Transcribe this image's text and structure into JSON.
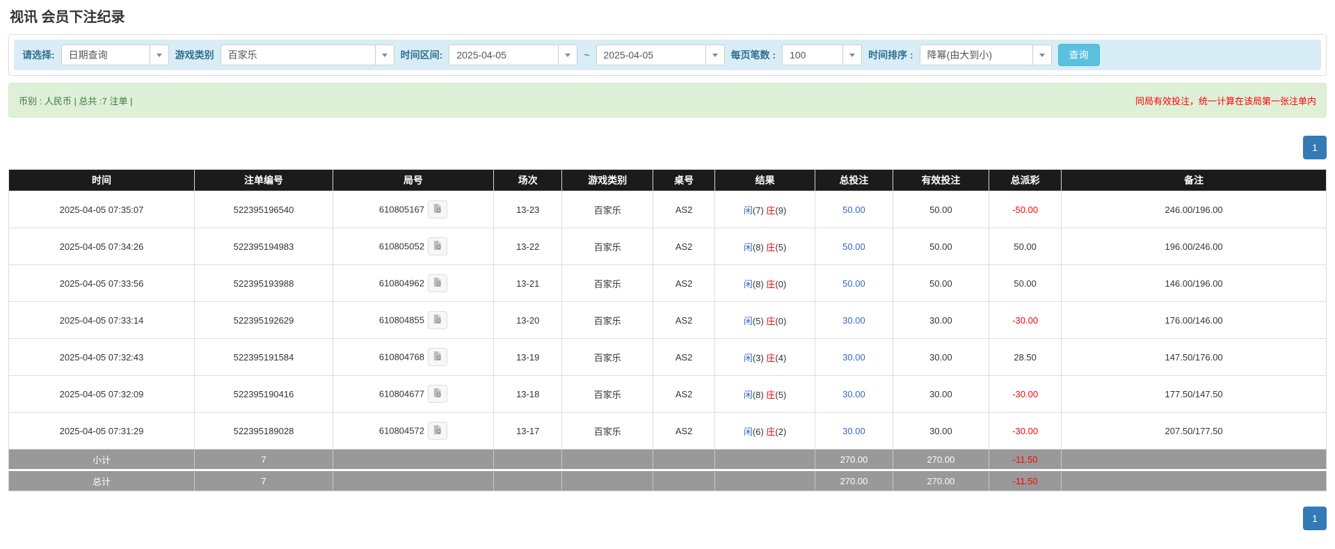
{
  "page": {
    "title": "视讯 会员下注纪录"
  },
  "filters": {
    "select_label": "请选择:",
    "select_value": "日期查询",
    "game_label": "游戏类别",
    "game_value": "百家乐",
    "time_range_label": "时间区间:",
    "date_from": "2025-04-05",
    "range_separator": "~",
    "date_to": "2025-04-05",
    "page_size_label": "每页笔数 :",
    "page_size_value": "100",
    "sort_label": "时间排序 :",
    "sort_value": "降幂(由大到小)",
    "search_button": "查询"
  },
  "summary": {
    "left_text": "币别 : 人民币 | 总共 :7 注单 |",
    "right_notice": "同局有效投注，统一计算在该局第一张注单内"
  },
  "pagination": {
    "page": "1"
  },
  "table": {
    "columns": [
      "时间",
      "注单编号",
      "局号",
      "场次",
      "游戏类别",
      "桌号",
      "结果",
      "总投注",
      "有效投注",
      "总派彩",
      "备注"
    ],
    "result_labels": {
      "player": "闲",
      "banker": "庄"
    },
    "rows": [
      {
        "time": "2025-04-05 07:35:07",
        "bet_id": "522395196540",
        "round_id": "610805167",
        "session": "13-23",
        "game": "百家乐",
        "table_no": "AS2",
        "player": "7",
        "banker": "9",
        "total_bet": "50.00",
        "valid_bet": "50.00",
        "payout": "-50.00",
        "remark": "246.00/196.00"
      },
      {
        "time": "2025-04-05 07:34:26",
        "bet_id": "522395194983",
        "round_id": "610805052",
        "session": "13-22",
        "game": "百家乐",
        "table_no": "AS2",
        "player": "8",
        "banker": "5",
        "total_bet": "50.00",
        "valid_bet": "50.00",
        "payout": "50.00",
        "remark": "196.00/246.00"
      },
      {
        "time": "2025-04-05 07:33:56",
        "bet_id": "522395193988",
        "round_id": "610804962",
        "session": "13-21",
        "game": "百家乐",
        "table_no": "AS2",
        "player": "8",
        "banker": "0",
        "total_bet": "50.00",
        "valid_bet": "50.00",
        "payout": "50.00",
        "remark": "146.00/196.00"
      },
      {
        "time": "2025-04-05 07:33:14",
        "bet_id": "522395192629",
        "round_id": "610804855",
        "session": "13-20",
        "game": "百家乐",
        "table_no": "AS2",
        "player": "5",
        "banker": "0",
        "total_bet": "30.00",
        "valid_bet": "30.00",
        "payout": "-30.00",
        "remark": "176.00/146.00"
      },
      {
        "time": "2025-04-05 07:32:43",
        "bet_id": "522395191584",
        "round_id": "610804768",
        "session": "13-19",
        "game": "百家乐",
        "table_no": "AS2",
        "player": "3",
        "banker": "4",
        "total_bet": "30.00",
        "valid_bet": "30.00",
        "payout": "28.50",
        "remark": "147.50/176.00"
      },
      {
        "time": "2025-04-05 07:32:09",
        "bet_id": "522395190416",
        "round_id": "610804677",
        "session": "13-18",
        "game": "百家乐",
        "table_no": "AS2",
        "player": "8",
        "banker": "5",
        "total_bet": "30.00",
        "valid_bet": "30.00",
        "payout": "-30.00",
        "remark": "177.50/147.50"
      },
      {
        "time": "2025-04-05 07:31:29",
        "bet_id": "522395189028",
        "round_id": "610804572",
        "session": "13-17",
        "game": "百家乐",
        "table_no": "AS2",
        "player": "6",
        "banker": "2",
        "total_bet": "30.00",
        "valid_bet": "30.00",
        "payout": "-30.00",
        "remark": "207.50/177.50"
      }
    ],
    "subtotal": {
      "label": "小计",
      "count": "7",
      "total_bet": "270.00",
      "valid_bet": "270.00",
      "payout": "-11.50"
    },
    "grand_total": {
      "label": "总计",
      "count": "7",
      "total_bet": "270.00",
      "valid_bet": "270.00",
      "payout": "-11.50"
    }
  },
  "colors": {
    "filter_bar_bg": "#d9edf7",
    "label_text": "#31708f",
    "search_button_bg": "#5bc0de",
    "alert_bg": "#dff0d8",
    "alert_text": "#3c763d",
    "notice_red": "#ff0000",
    "pager_blue": "#337ab7",
    "header_bg": "#1b1b1b",
    "sum_row_bg": "#999999",
    "link_blue": "#3366cc",
    "negative_red": "#ff0000"
  }
}
